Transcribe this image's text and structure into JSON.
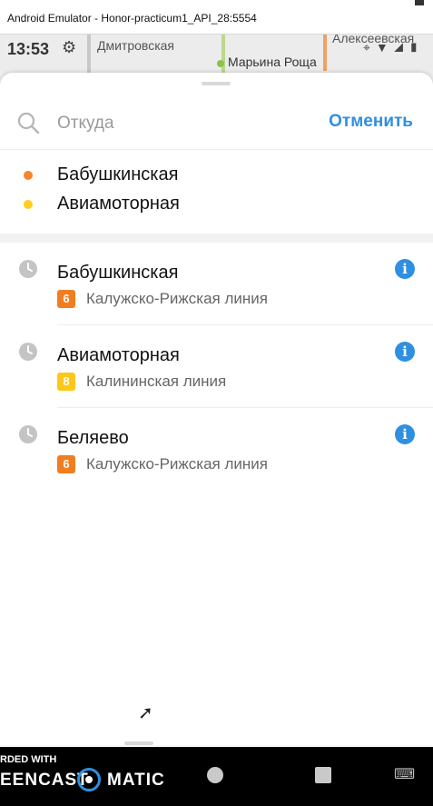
{
  "window": {
    "title": "Android Emulator - Honor-practicum1_API_28:5554"
  },
  "map": {
    "labels": [
      "Дмитровская",
      "Алексеевская",
      "Марьина Роща"
    ]
  },
  "status_bar": {
    "time": "13:53"
  },
  "search": {
    "placeholder": "Откуда",
    "value": "",
    "cancel_label": "Отменить"
  },
  "selected_stations": [
    {
      "name": "Бабушкинская",
      "color": "#f5862b"
    },
    {
      "name": "Авиамоторная",
      "color": "#ffcd1c"
    }
  ],
  "history": [
    {
      "name": "Бабушкинская",
      "line_number": "6",
      "line_name": "Калужско-Рижская линия",
      "line_color": "#f07e21"
    },
    {
      "name": "Авиамоторная",
      "line_number": "8",
      "line_name": "Калининская линия",
      "line_color": "#ffc61a"
    },
    {
      "name": "Беляево",
      "line_number": "6",
      "line_name": "Калужско-Рижская линия",
      "line_color": "#f07e21"
    }
  ],
  "watermark": {
    "top": "RDED WITH",
    "left": "EENCAST",
    "right": "MATIC"
  },
  "colors": {
    "accent": "#2f8fe0"
  }
}
